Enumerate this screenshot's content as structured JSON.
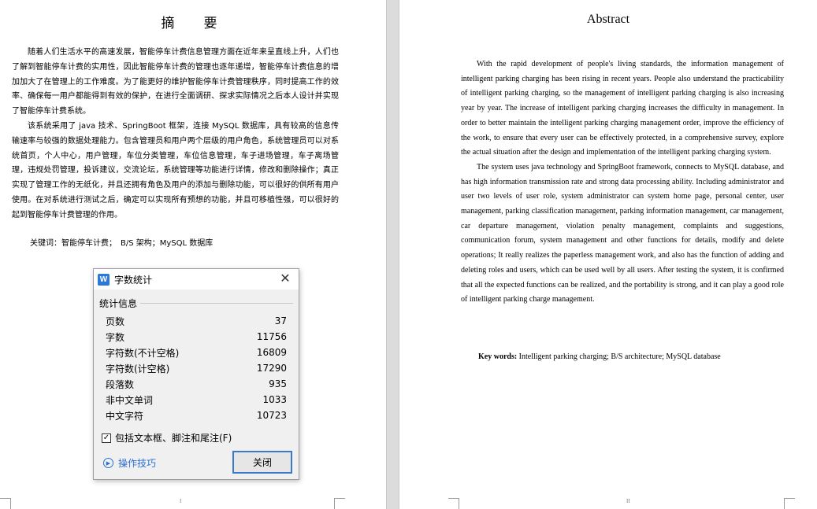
{
  "left_page": {
    "title": "摘　要",
    "paragraphs": [
      "随着人们生活水平的高速发展，智能停车计费信息管理方面在近年来呈直线上升，人们也了解到智能停车计费的实用性，因此智能停车计费的管理也逐年递增，智能停车计费信息的增加加大了在管理上的工作难度。为了能更好的维护智能停车计费管理秩序，同时提高工作的效率、确保每一用户都能得到有效的保护，在进行全面调研、探求实际情况之后本人设计并实现了智能停车计费系统。",
      "该系统采用了 java 技术、SpringBoot 框架，连接 MySQL 数据库，具有较高的信息传输速率与较强的数据处理能力。包含管理员和用户两个层级的用户角色，系统管理员可以对系统首页，个人中心，用户管理，车位分类管理，车位信息管理，车子进场管理，车子离场管理，违规处罚管理，投诉建议，交流论坛，系统管理等功能进行详情，修改和删除操作；真正实现了管理工作的无纸化，并且还拥有角色及用户的添加与删除功能，可以很好的供所有用户使用。在对系统进行测试之后，确定可以实现所有预想的功能，并且可移植性强，可以很好的起到智能停车计费管理的作用。"
    ],
    "keywords": "关键词：智能停车计费；　B/S 架构；MySQL 数据库",
    "page_number": "I"
  },
  "right_page": {
    "title": "Abstract",
    "paragraphs": [
      "With the rapid development of people's living standards, the information management of intelligent parking charging has been rising in recent years. People also understand the practicability of intelligent parking charging, so the management of intelligent parking charging is also increasing year by year. The increase of intelligent parking charging increases the difficulty in management. In order to better maintain the intelligent parking charging management order, improve the efficiency of the work, to ensure that every user can be effectively protected, in a comprehensive survey, explore the actual situation after the design and implementation of the intelligent parking charging system.",
      "The system uses java technology and SpringBoot framework, connects to MySQL database, and has high information transmission rate and strong data processing ability. Including administrator and user two levels of user role, system administrator can system home page, personal center, user management, parking classification management, parking information management, car management, car departure management, violation penalty management, complaints and suggestions, communication forum, system management and other functions for details, modify and delete operations; It really realizes the paperless management work, and also has the function of adding and deleting roles and users, which can be used well by all users. After testing the system, it is confirmed that all the expected functions can be realized, and the portability is strong, and it can play a good role of intelligent parking charge management."
    ],
    "keywords_label": "Key words:",
    "keywords_value": "Intelligent parking charging; B/S architecture; MySQL database",
    "page_number": "II"
  },
  "dialog": {
    "icon_letter": "W",
    "title": "字数统计",
    "close_glyph": "✕",
    "section_label": "统计信息",
    "stats": [
      {
        "label": "页数",
        "value": "37"
      },
      {
        "label": "字数",
        "value": "11756"
      },
      {
        "label": "字符数(不计空格)",
        "value": "16809"
      },
      {
        "label": "字符数(计空格)",
        "value": "17290"
      },
      {
        "label": "段落数",
        "value": "935"
      },
      {
        "label": "非中文单词",
        "value": "1033"
      },
      {
        "label": "中文字符",
        "value": "10723"
      }
    ],
    "checkbox_label": "包括文本框、脚注和尾注(F)",
    "checkbox_checked": true,
    "tips_label": "操作技巧",
    "close_button": "关闭",
    "accent_color": "#2b79d6"
  }
}
